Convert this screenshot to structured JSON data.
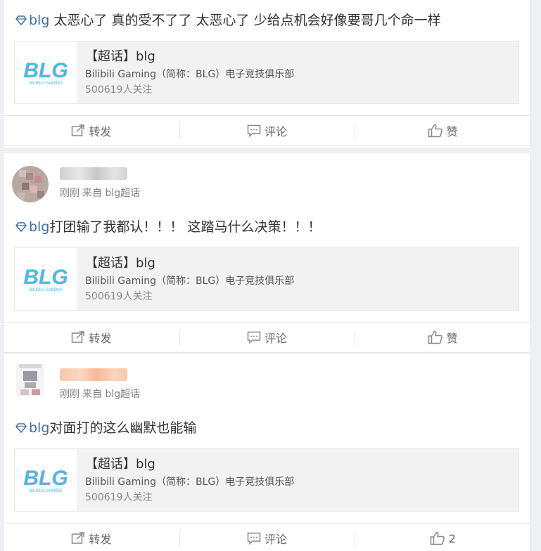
{
  "posts": [
    {
      "text_prefix": "blg",
      "text_body": " 太恶心了 真的受不了了 太恶心了 少给点机会好像要哥几个命一样",
      "card": {
        "title": "【超话】blg",
        "desc": "Bilibili Gaming（简称：BLG）电子竞技俱乐部",
        "followers": "500619人关注",
        "logo_text": "BLG",
        "logo_sub": "BILIBILI GAMING"
      },
      "actions": {
        "repost": "转发",
        "comment": "评论",
        "like": "赞"
      }
    },
    {
      "meta_time": "刚刚",
      "meta_from": "来自 blg超话",
      "text_prefix": "blg",
      "text_body": "打团输了我都认！！！ 这踏马什么决策！！！",
      "card": {
        "title": "【超话】blg",
        "desc": "Bilibili Gaming（简称：BLG）电子竞技俱乐部",
        "followers": "500619人关注",
        "logo_text": "BLG",
        "logo_sub": "BILIBILI GAMING"
      },
      "actions": {
        "repost": "转发",
        "comment": "评论",
        "like": "赞"
      }
    },
    {
      "meta_time": "刚刚",
      "meta_from": "来自 blg超话",
      "text_prefix": "blg",
      "text_body": "对面打的这么幽默也能输",
      "card": {
        "title": "【超话】blg",
        "desc": "Bilibili Gaming（简称：BLG）电子竞技俱乐部",
        "followers": "500619人关注",
        "logo_text": "BLG",
        "logo_sub": "BILIBILI GAMING"
      },
      "actions": {
        "repost": "转发",
        "comment": "评论",
        "like": "2"
      }
    }
  ],
  "colors": {
    "link": "#3d6fa5",
    "logo_cyan": "#35c3e8",
    "logo_pink": "#f3a3b9"
  },
  "icons": [
    "diamond-icon",
    "repost-icon",
    "comment-icon",
    "like-icon"
  ]
}
